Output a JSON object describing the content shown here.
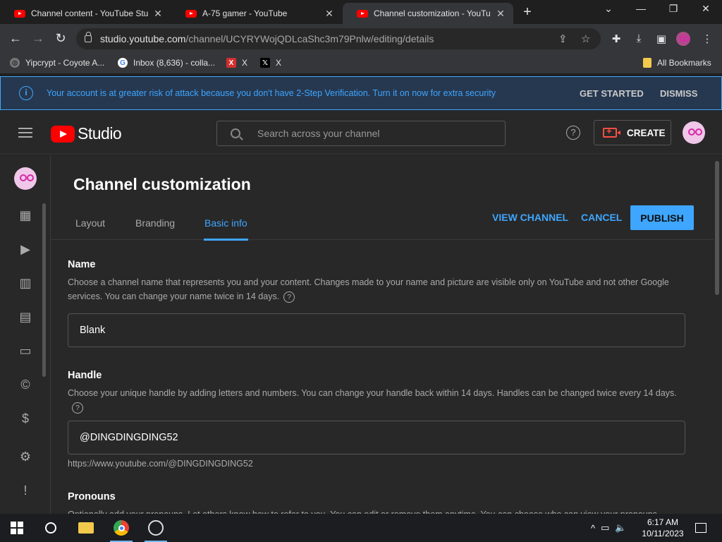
{
  "browser": {
    "tabs": [
      {
        "title": "Channel content - YouTube Studio"
      },
      {
        "title": "A-75 gamer - YouTube"
      },
      {
        "title": "Channel customization - YouTube Studio"
      }
    ],
    "url_host": "studio.youtube.com",
    "url_path": "/channel/UCYRYWojQDLcaShc3m79Pnlw/editing/details",
    "bookmarks": [
      {
        "label": "Yipcrypt - Coyote A..."
      },
      {
        "label": "Inbox (8,636) - colla..."
      },
      {
        "label": "X"
      },
      {
        "label": "X"
      }
    ],
    "all_bookmarks": "All Bookmarks"
  },
  "banner": {
    "message": "Your account is at greater risk of attack because you don't have 2-Step Verification. Turn it on now for extra security",
    "get_started": "GET STARTED",
    "dismiss": "DISMISS"
  },
  "header": {
    "logo_text": "Studio",
    "search_placeholder": "Search across your channel",
    "create_label": "CREATE"
  },
  "page": {
    "title": "Channel customization",
    "tabs": [
      {
        "label": "Layout"
      },
      {
        "label": "Branding"
      },
      {
        "label": "Basic info"
      }
    ],
    "selected_tab": "Basic info",
    "view_channel": "VIEW CHANNEL",
    "cancel": "CANCEL",
    "publish": "PUBLISH"
  },
  "name_section": {
    "heading": "Name",
    "description": "Choose a channel name that represents you and your content. Changes made to your name and picture are visible only on YouTube and not other Google services. You can change your name twice in 14 days.",
    "value": "Blank"
  },
  "handle_section": {
    "heading": "Handle",
    "description": "Choose your unique handle by adding letters and numbers. You can change your handle back within 14 days. Handles can be changed twice every 14 days.",
    "value": "@DINGDINGDING52",
    "url_hint": "https://www.youtube.com/@DINGDINGDING52"
  },
  "pronouns_section": {
    "heading": "Pronouns",
    "description": "Optionally add your pronouns. Let others know how to refer to you. You can edit or remove them anytime. You can choose who can view your pronouns."
  },
  "taskbar": {
    "time": "6:17 AM",
    "date": "10/11/2023"
  },
  "colors": {
    "accent": "#3ea6ff",
    "youtube_red": "#ff0000",
    "background": "#282828"
  }
}
